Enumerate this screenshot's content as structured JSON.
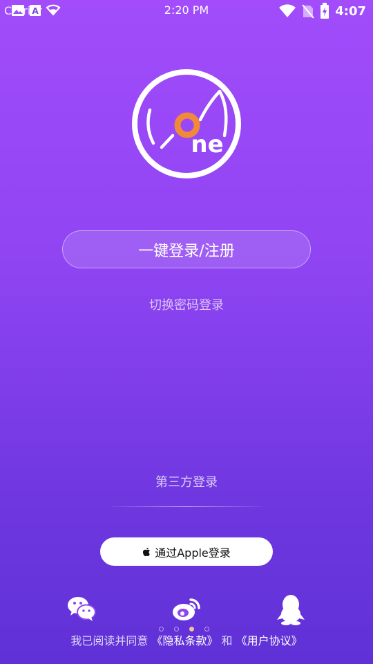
{
  "status_bar": {
    "carrier": "Carrier",
    "time": "2:20 PM",
    "battery_text": "4:07"
  },
  "login": {
    "primary_button_label": "一键登录/注册",
    "switch_password_label": "切换密码登录"
  },
  "third_party": {
    "title": "第三方登录",
    "apple_button_label": "通过Apple登录"
  },
  "agreement": {
    "prefix": "我已阅读并同意",
    "privacy_link": "《隐私条款》",
    "conjunction": "和",
    "user_agreement_link": "《用户协议》"
  },
  "pager": {
    "count": 4,
    "active_index": 2
  },
  "colors": {
    "gradient_top": "#a24cfb",
    "gradient_bottom": "#5f31d6",
    "logo_accent": "#f08a3a",
    "active_dot": "#f2c3a1"
  }
}
